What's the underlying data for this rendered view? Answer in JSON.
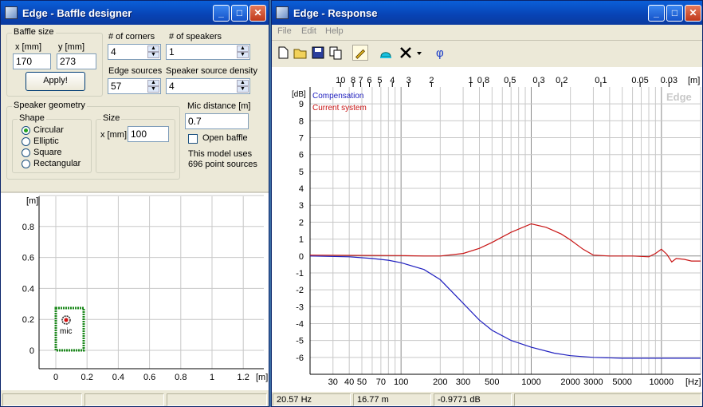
{
  "designer": {
    "title": "Edge - Baffle designer",
    "baffle_size_label": "Baffle size",
    "x_label": "x [mm]",
    "y_label": "y [mm]",
    "x_value": "170",
    "y_value": "273",
    "apply_label": "Apply!",
    "corners_label": "# of corners",
    "corners_value": "4",
    "speakers_label": "# of speakers",
    "speakers_value": "1",
    "edge_sources_label": "Edge sources",
    "edge_sources_value": "57",
    "density_label": "Speaker source density",
    "density_value": "4",
    "geometry_label": "Speaker geometry",
    "shape_label": "Shape",
    "shapes": [
      "Circular",
      "Elliptic",
      "Square",
      "Rectangular"
    ],
    "selected_shape": 0,
    "size_label": "Size",
    "size_x_label": "x [mm]",
    "size_x_value": "100",
    "mic_label": "Mic distance [m]",
    "mic_value": "0.7",
    "open_baffle_label": "Open baffle",
    "open_baffle_checked": false,
    "model_line1": "This model uses",
    "model_line2": "696 point sources",
    "plot": {
      "y_unit": "[m]",
      "x_unit": "[m]",
      "y_ticks": [
        "0.8",
        "0.6",
        "0.4",
        "0.2",
        "0"
      ],
      "x_ticks": [
        "0",
        "0.2",
        "0.4",
        "0.6",
        "0.8",
        "1",
        "1.2"
      ],
      "mic_label": "mic"
    }
  },
  "response": {
    "title": "Edge - Response",
    "menu": [
      "File",
      "Edit",
      "Help"
    ],
    "watermark": "Edge",
    "y_unit": "[dB]",
    "x_unit": "[Hz]",
    "top_unit": "[m]",
    "legend": [
      {
        "name": "Compensation",
        "color": "#1f1fbf"
      },
      {
        "name": "Current system",
        "color": "#c81414"
      }
    ],
    "status": [
      "20.57 Hz",
      "16.77 m",
      "-0.9771 dB"
    ]
  },
  "chart_data": {
    "type": "line",
    "x_scale": "log",
    "xlim": [
      20,
      20000
    ],
    "ylim": [
      -7,
      10
    ],
    "ylabel": "[dB]",
    "xlabel": "[Hz]",
    "x_ticks": [
      "30",
      "40",
      "50",
      "70",
      "100",
      "200",
      "300",
      "500",
      "1000",
      "2000",
      "3000",
      "5000",
      "10000"
    ],
    "y_ticks": [
      "9",
      "8",
      "7",
      "6",
      "5",
      "4",
      "3",
      "2",
      "1",
      "0",
      "-1",
      "-2",
      "-3",
      "-4",
      "-5",
      "-6"
    ],
    "top_ticks": [
      "10",
      "8",
      "7",
      "6",
      "5",
      "4",
      "3",
      "2",
      "1",
      "0.8",
      "0.5",
      "0.3",
      "0.2",
      "0.1",
      "0.05",
      "0.03"
    ],
    "series": [
      {
        "name": "Compensation",
        "color": "#1f1fbf",
        "x": [
          20,
          40,
          60,
          80,
          100,
          150,
          200,
          300,
          400,
          500,
          700,
          1000,
          1500,
          2000,
          3000,
          5000,
          10000,
          20000
        ],
        "y": [
          0,
          -0.05,
          -0.15,
          -0.25,
          -0.4,
          -0.8,
          -1.4,
          -2.8,
          -3.8,
          -4.4,
          -5.0,
          -5.4,
          -5.75,
          -5.9,
          -6.0,
          -6.05,
          -6.05,
          -6.05
        ]
      },
      {
        "name": "Current system",
        "color": "#c81414",
        "x": [
          20,
          100,
          150,
          200,
          300,
          400,
          500,
          700,
          1000,
          1300,
          1700,
          2000,
          2500,
          3000,
          4000,
          6000,
          8000,
          9000,
          10000,
          11000,
          12000,
          13000,
          15000,
          17000,
          20000
        ],
        "y": [
          0.05,
          0.02,
          0.0,
          0.0,
          0.15,
          0.45,
          0.8,
          1.4,
          1.9,
          1.7,
          1.3,
          0.95,
          0.4,
          0.05,
          0.0,
          0.0,
          -0.05,
          0.15,
          0.4,
          0.1,
          -0.35,
          -0.15,
          -0.2,
          -0.3,
          -0.3
        ]
      }
    ]
  }
}
